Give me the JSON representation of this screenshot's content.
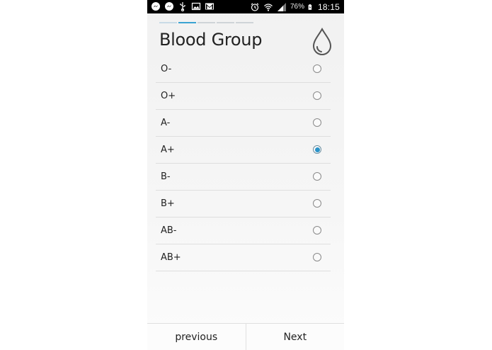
{
  "statusbar": {
    "notifications": [
      "messenger-icon",
      "messenger-icon",
      "usb-icon",
      "image-icon",
      "gmail-icon"
    ],
    "battery_percent": "76%",
    "time": "18:15"
  },
  "wizard": {
    "steps_total": 5,
    "steps_done": 1,
    "active_step": 2
  },
  "page": {
    "title": "Blood Group",
    "icon": "blood-drop-icon"
  },
  "options": [
    {
      "label": "O-",
      "selected": false
    },
    {
      "label": "O+",
      "selected": false
    },
    {
      "label": "A-",
      "selected": false
    },
    {
      "label": "A+",
      "selected": true
    },
    {
      "label": "B-",
      "selected": false
    },
    {
      "label": "B+",
      "selected": false
    },
    {
      "label": "AB-",
      "selected": false
    },
    {
      "label": "AB+",
      "selected": false
    }
  ],
  "nav": {
    "previous_label": "previous",
    "next_label": "Next"
  },
  "colors": {
    "accent": "#2a93c9",
    "progress_active": "#3aa3d2"
  }
}
